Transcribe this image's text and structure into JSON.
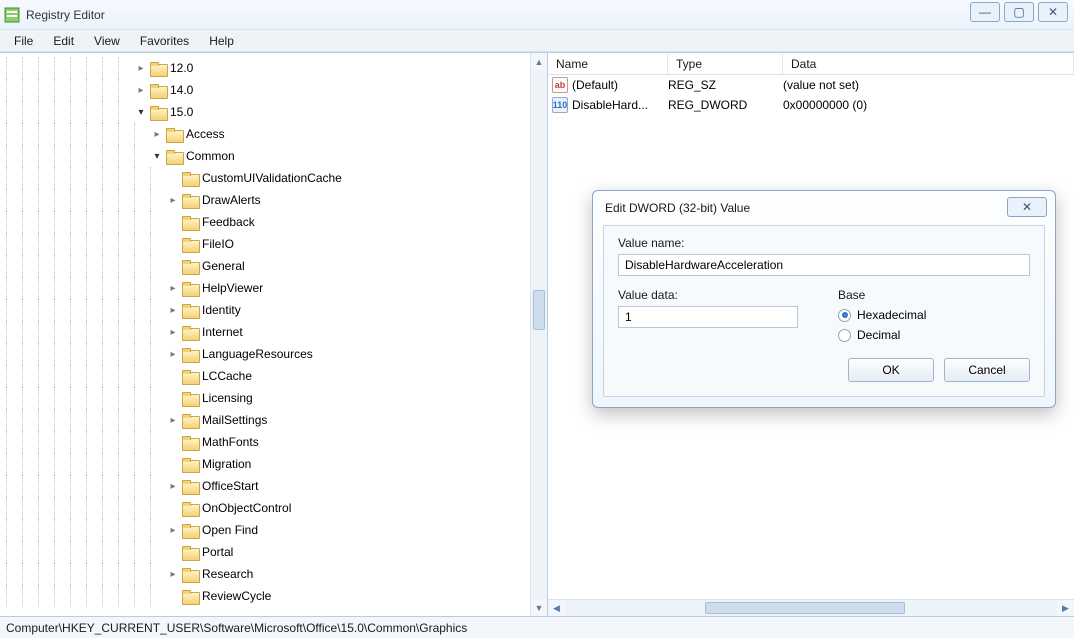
{
  "window": {
    "title": "Registry Editor",
    "controls": {
      "min": "—",
      "max": "▢",
      "close": "✕"
    }
  },
  "menu": [
    "File",
    "Edit",
    "View",
    "Favorites",
    "Help"
  ],
  "tree": [
    {
      "depth": 8,
      "expander": "closed",
      "label": "12.0"
    },
    {
      "depth": 8,
      "expander": "closed",
      "label": "14.0"
    },
    {
      "depth": 8,
      "expander": "open",
      "label": "15.0"
    },
    {
      "depth": 9,
      "expander": "closed",
      "label": "Access"
    },
    {
      "depth": 9,
      "expander": "open",
      "label": "Common"
    },
    {
      "depth": 10,
      "expander": "none",
      "label": "CustomUIValidationCache"
    },
    {
      "depth": 10,
      "expander": "closed",
      "label": "DrawAlerts"
    },
    {
      "depth": 10,
      "expander": "none",
      "label": "Feedback"
    },
    {
      "depth": 10,
      "expander": "none",
      "label": "FileIO"
    },
    {
      "depth": 10,
      "expander": "none",
      "label": "General"
    },
    {
      "depth": 10,
      "expander": "closed",
      "label": "HelpViewer"
    },
    {
      "depth": 10,
      "expander": "closed",
      "label": "Identity"
    },
    {
      "depth": 10,
      "expander": "closed",
      "label": "Internet"
    },
    {
      "depth": 10,
      "expander": "closed",
      "label": "LanguageResources"
    },
    {
      "depth": 10,
      "expander": "none",
      "label": "LCCache"
    },
    {
      "depth": 10,
      "expander": "none",
      "label": "Licensing"
    },
    {
      "depth": 10,
      "expander": "closed",
      "label": "MailSettings"
    },
    {
      "depth": 10,
      "expander": "none",
      "label": "MathFonts"
    },
    {
      "depth": 10,
      "expander": "none",
      "label": "Migration"
    },
    {
      "depth": 10,
      "expander": "closed",
      "label": "OfficeStart"
    },
    {
      "depth": 10,
      "expander": "none",
      "label": "OnObjectControl"
    },
    {
      "depth": 10,
      "expander": "closed",
      "label": "Open Find"
    },
    {
      "depth": 10,
      "expander": "none",
      "label": "Portal"
    },
    {
      "depth": 10,
      "expander": "closed",
      "label": "Research"
    },
    {
      "depth": 10,
      "expander": "none",
      "label": "ReviewCycle"
    }
  ],
  "list": {
    "columns": {
      "name": "Name",
      "type": "Type",
      "data": "Data"
    },
    "rows": [
      {
        "icon": "sz",
        "name": "(Default)",
        "type": "REG_SZ",
        "data": "(value not set)"
      },
      {
        "icon": "dw",
        "name": "DisableHard...",
        "type": "REG_DWORD",
        "data": "0x00000000 (0)"
      }
    ]
  },
  "dialog": {
    "title": "Edit DWORD (32-bit) Value",
    "close_glyph": "✕",
    "value_name_label": "Value name:",
    "value_name": "DisableHardwareAcceleration",
    "value_data_label": "Value data:",
    "value_data": "1",
    "base_label": "Base",
    "hex_label": "Hexadecimal",
    "dec_label": "Decimal",
    "base_selected": "hex",
    "ok": "OK",
    "cancel": "Cancel"
  },
  "status_path": "Computer\\HKEY_CURRENT_USER\\Software\\Microsoft\\Office\\15.0\\Common\\Graphics"
}
